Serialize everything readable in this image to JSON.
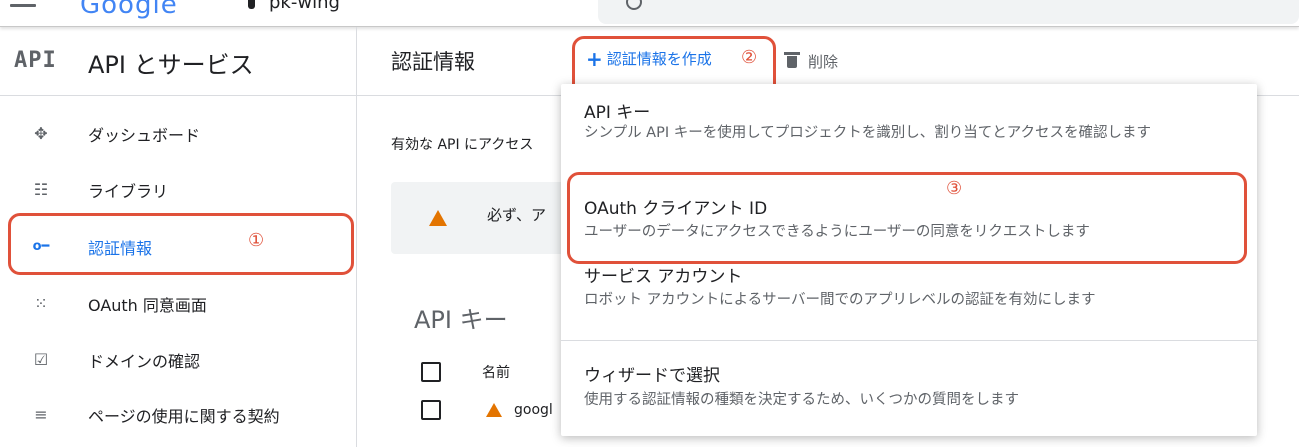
{
  "topbar": {
    "logo": "Google",
    "project": "pk-wing"
  },
  "sidebar": {
    "logo": "API",
    "title": "API とサービス",
    "items": [
      {
        "label": "ダッシュボード",
        "icon": "dashboard-icon",
        "glyph": "✥"
      },
      {
        "label": "ライブラリ",
        "icon": "library-icon",
        "glyph": "☷"
      },
      {
        "label": "認証情報",
        "icon": "key-icon",
        "glyph": "o━",
        "active": true
      },
      {
        "label": "OAuth 同意画面",
        "icon": "consent-icon",
        "glyph": "⁙"
      },
      {
        "label": "ドメインの確認",
        "icon": "checkbox-icon",
        "glyph": "☑"
      },
      {
        "label": "ページの使用に関する契約",
        "icon": "settings-list-icon",
        "glyph": "≡"
      }
    ]
  },
  "annotations": {
    "one": "①",
    "two": "②",
    "three": "③",
    "color": "#e0513a"
  },
  "main": {
    "title": "認証情報",
    "create_label": "認証情報を作成",
    "delete_label": "削除",
    "info_text": "有効な API にアクセス",
    "warning_text": "必ず、ア",
    "api_key_section": "API キー",
    "table": {
      "col_name": "名前",
      "row_name": "googl"
    }
  },
  "menu": {
    "items": [
      {
        "title": "API キー",
        "desc": "シンプル API キーを使用してプロジェクトを識別し、割り当てとアクセスを確認します"
      },
      {
        "title": "OAuth クライアント ID",
        "desc": "ユーザーのデータにアクセスできるようにユーザーの同意をリクエストします"
      },
      {
        "title": "サービス アカウント",
        "desc": "ロボット アカウントによるサーバー間でのアプリレベルの認証を有効にします"
      },
      {
        "title": "ウィザードで選択",
        "desc": "使用する認証情報の種類を決定するため、いくつかの質問をします"
      }
    ]
  },
  "colors": {
    "accent": "#1a73e8",
    "warning": "#e37400",
    "annotation": "#e0513a"
  }
}
